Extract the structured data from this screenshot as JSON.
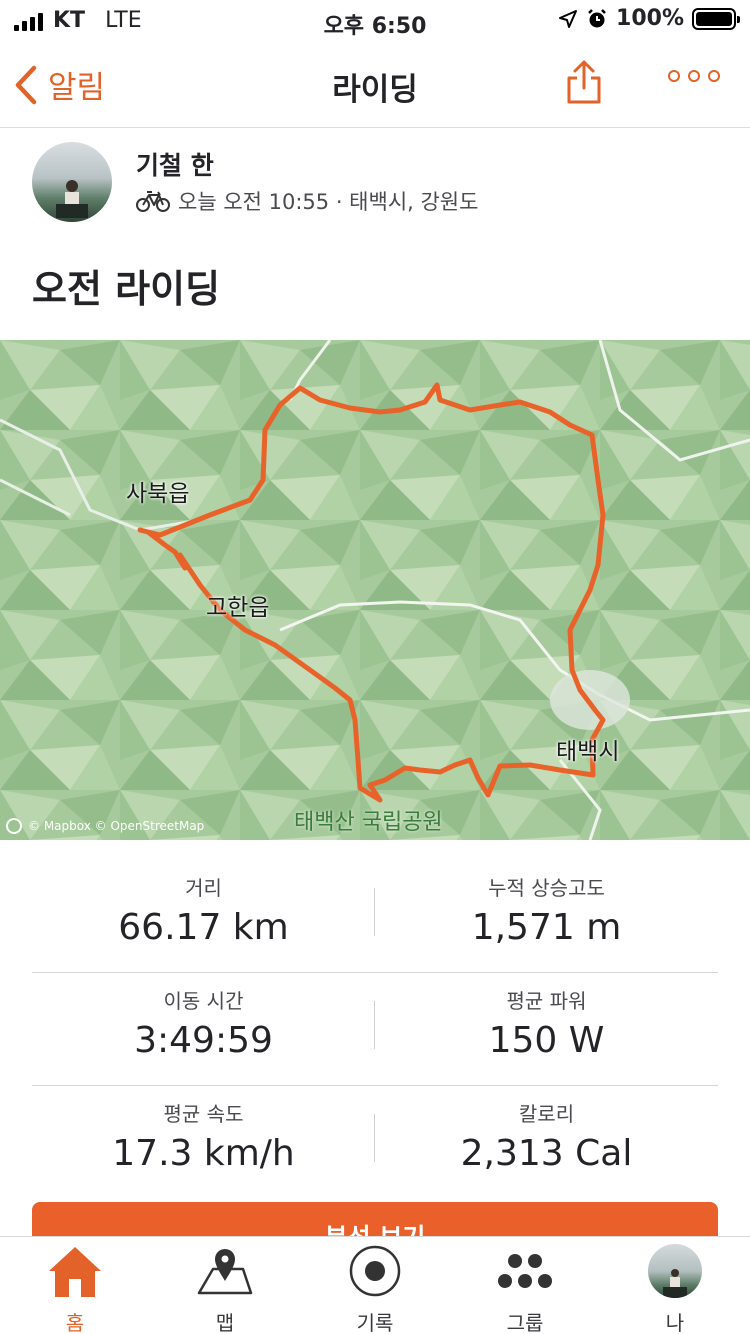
{
  "status_bar": {
    "carrier": "KT",
    "network": "LTE",
    "time": "오후 6:50",
    "battery": "100%"
  },
  "nav": {
    "back_label": "알림",
    "title": "라이딩"
  },
  "athlete": {
    "name": "기철 한",
    "meta": "오늘 오전 10:55 · 태백시, 강원도"
  },
  "activity": {
    "title": "오전 라이딩"
  },
  "map": {
    "labels": {
      "town1": "사북읍",
      "town2": "고한읍",
      "city": "태백시",
      "park": "태백산 국립공원"
    },
    "attribution": "© Mapbox © OpenStreetMap",
    "route_color": "#e8632a"
  },
  "stats": [
    {
      "label": "거리",
      "value": "66.17 km"
    },
    {
      "label": "누적 상승고도",
      "value": "1,571 m"
    },
    {
      "label": "이동 시간",
      "value": "3:49:59"
    },
    {
      "label": "평균 파워",
      "value": "150 W"
    },
    {
      "label": "평균 속도",
      "value": "17.3 km/h"
    },
    {
      "label": "칼로리",
      "value": "2,313 Cal"
    }
  ],
  "analysis_button": "분석 보기",
  "tabs": [
    {
      "label": "홈",
      "icon": "home-icon",
      "active": true
    },
    {
      "label": "맵",
      "icon": "map-icon",
      "active": false
    },
    {
      "label": "기록",
      "icon": "record-icon",
      "active": false
    },
    {
      "label": "그룹",
      "icon": "groups-icon",
      "active": false
    },
    {
      "label": "나",
      "icon": "profile-avatar",
      "active": false
    }
  ],
  "colors": {
    "accent": "#e2622a",
    "button": "#e9602b",
    "map_green": "#a9cc9f"
  }
}
